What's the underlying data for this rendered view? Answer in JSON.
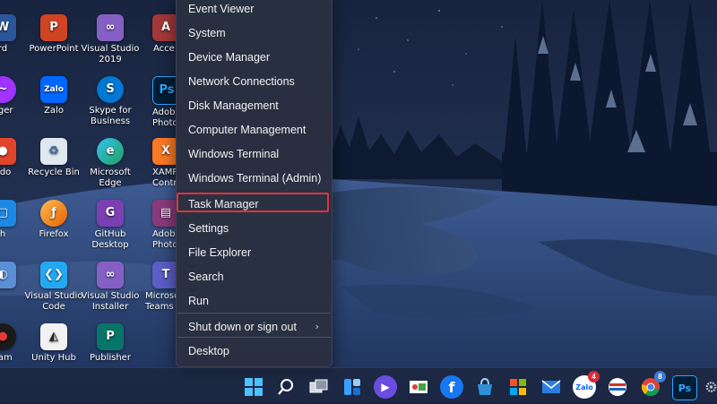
{
  "accent": {
    "highlight_border": "#e0323c",
    "menu_bg": "#293040"
  },
  "desktop": {
    "icons": [
      {
        "label": "rd",
        "icon": "word-icon"
      },
      {
        "label": "PowerPoint",
        "icon": "powerpoint-icon"
      },
      {
        "label": "Visual Studio",
        "label2": "2019",
        "icon": "visual-studio-icon"
      },
      {
        "label": "Acce",
        "icon": "access-icon"
      },
      {
        "label": "nger",
        "icon": "messenger-icon"
      },
      {
        "label": "Zalo",
        "icon": "zalo-icon"
      },
      {
        "label": "Skype for",
        "label2": "Business",
        "icon": "skype-icon"
      },
      {
        "label": "Adob",
        "label2": "Photos",
        "icon": "photoshop-icon"
      },
      {
        "label": "ado",
        "icon": "app-icon"
      },
      {
        "label": "Recycle Bin",
        "icon": "recycle-bin-icon"
      },
      {
        "label": "Microsoft",
        "label2": "Edge",
        "icon": "edge-icon"
      },
      {
        "label": "XAMP",
        "label2": "Contr",
        "icon": "xampp-icon"
      },
      {
        "label": "h",
        "icon": "app-icon"
      },
      {
        "label": "Firefox",
        "icon": "firefox-icon"
      },
      {
        "label": "GitHub",
        "label2": "Desktop",
        "icon": "github-desktop-icon"
      },
      {
        "label": "Adob",
        "label2": "Photos",
        "icon": "winrar-icon"
      },
      {
        "label": "",
        "icon": "app-icon"
      },
      {
        "label": "Visual Studio",
        "label2": "Code",
        "icon": "vscode-icon"
      },
      {
        "label": "Visual Studio",
        "label2": "Installer",
        "icon": "vs-installer-icon"
      },
      {
        "label": "Microso",
        "label2": "Teams (w",
        "icon": "teams-icon"
      },
      {
        "label": "cam",
        "icon": "camera-icon"
      },
      {
        "label": "Unity Hub",
        "icon": "unity-hub-icon"
      },
      {
        "label": "Publisher",
        "icon": "publisher-icon"
      }
    ]
  },
  "menu": {
    "items": [
      "Event Viewer",
      "System",
      "Device Manager",
      "Network Connections",
      "Disk Management",
      "Computer Management",
      "Windows Terminal",
      "Windows Terminal (Admin)",
      "Task Manager",
      "Settings",
      "File Explorer",
      "Search",
      "Run",
      "Shut down or sign out",
      "Desktop"
    ],
    "highlighted": "Task Manager",
    "submenu_glyph": "›"
  },
  "taskbar": {
    "icons": [
      {
        "name": "start-icon"
      },
      {
        "name": "search-icon"
      },
      {
        "name": "task-view-icon"
      },
      {
        "name": "widgets-icon"
      },
      {
        "name": "chat-icon"
      },
      {
        "name": "snipping-icon"
      },
      {
        "name": "facebook-icon"
      },
      {
        "name": "store-bag-icon"
      },
      {
        "name": "microsoft-store-icon"
      },
      {
        "name": "mail-icon"
      },
      {
        "name": "zalo-icon",
        "badge": "4"
      },
      {
        "name": "flag-app-icon"
      },
      {
        "name": "chrome-icon",
        "badge": "8"
      },
      {
        "name": "photoshop-icon",
        "text": "Ps"
      },
      {
        "name": "settings-icon"
      }
    ]
  }
}
